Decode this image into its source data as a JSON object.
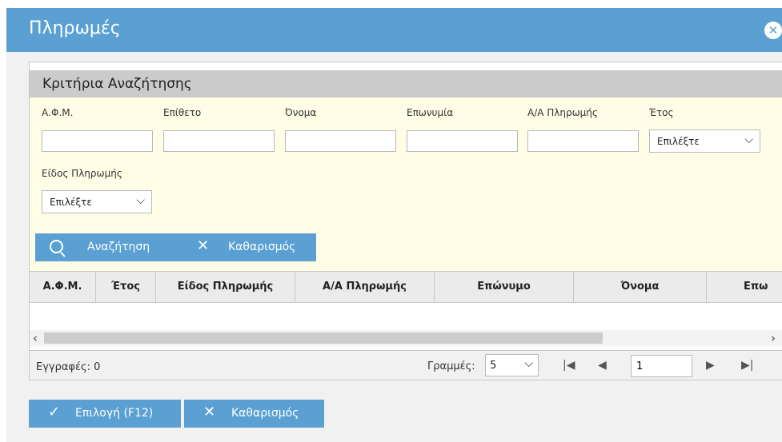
{
  "window": {
    "title": "Πληρωμές",
    "close_icon": "close-circle-icon"
  },
  "criteria": {
    "title": "Κριτήρια Αναζήτησης",
    "fields": {
      "afm": {
        "label": "Α.Φ.Μ.",
        "value": ""
      },
      "surname": {
        "label": "Επίθετο",
        "value": ""
      },
      "name": {
        "label": "Όνομα",
        "value": ""
      },
      "company": {
        "label": "Επωνυμία",
        "value": ""
      },
      "payment_no": {
        "label": "Α/Α Πληρωμής",
        "value": ""
      },
      "year": {
        "label": "Έτος",
        "selected": "Επιλέξτε"
      },
      "payment_type": {
        "label": "Είδος Πληρωμής",
        "selected": "Επιλέξτε"
      }
    },
    "search_button": "Αναζήτηση",
    "clear_button": "Καθαρισμός"
  },
  "grid": {
    "columns": [
      "Α.Φ.Μ.",
      "Έτος",
      "Είδος Πληρωμής",
      "Α/Α Πληρωμής",
      "Επώνυμο",
      "Όνομα",
      "Επω"
    ],
    "rows": []
  },
  "footer": {
    "records_label": "Εγγραφές: 0",
    "rows_label": "Γραμμές:",
    "rows_value": "5",
    "page_value": "1"
  },
  "actions": {
    "select_button": "Επιλογή (F12)",
    "clear_button": "Καθαρισμός"
  },
  "colors": {
    "accent": "#5aa0d3",
    "criteria_bg": "#fffde6",
    "header_bg": "#cbcbcb"
  }
}
